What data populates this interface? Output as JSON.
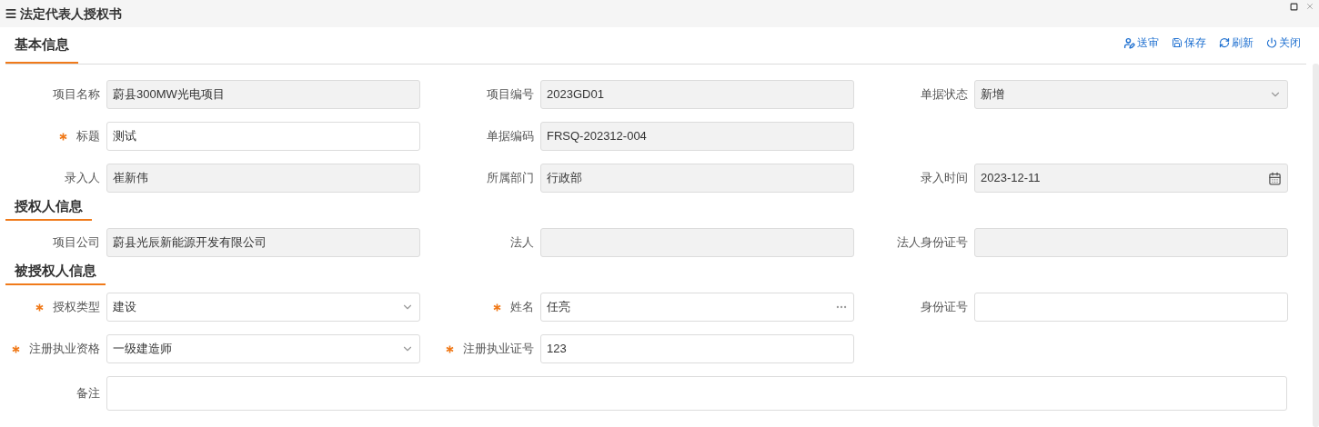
{
  "window": {
    "title": "法定代表人授权书"
  },
  "toolbar": [
    {
      "kind": "submit",
      "label": "送审"
    },
    {
      "kind": "save",
      "label": "保存"
    },
    {
      "kind": "refresh",
      "label": "刷新"
    },
    {
      "kind": "close",
      "label": "关闭"
    }
  ],
  "sections": [
    {
      "title": "基本信息",
      "rows": [
        [
          {
            "label": "项目名称",
            "value": "蔚县300MW光电项目",
            "kind": "text",
            "readonly": true,
            "required": false
          },
          {
            "label": "项目编号",
            "value": "2023GD01",
            "kind": "text",
            "readonly": true,
            "required": false
          },
          {
            "label": "单据状态",
            "value": "新增",
            "kind": "select",
            "readonly": true,
            "required": false
          }
        ],
        [
          {
            "label": "标题",
            "value": "测试",
            "kind": "text",
            "readonly": false,
            "required": true
          },
          {
            "label": "单据编码",
            "value": "FRSQ-202312-004",
            "kind": "text",
            "readonly": true,
            "required": false
          }
        ],
        [
          {
            "label": "录入人",
            "value": "崔新伟",
            "kind": "text",
            "readonly": true,
            "required": false
          },
          {
            "label": "所属部门",
            "value": "行政部",
            "kind": "text",
            "readonly": true,
            "required": false
          },
          {
            "label": "录入时间",
            "value": "2023-12-11",
            "kind": "date",
            "readonly": true,
            "required": false
          }
        ]
      ]
    },
    {
      "title": "授权人信息",
      "rows": [
        [
          {
            "label": "项目公司",
            "value": "蔚县光辰新能源开发有限公司",
            "kind": "text",
            "readonly": true,
            "required": false
          },
          {
            "label": "法人",
            "kind": "text",
            "readonly": true,
            "required": false
          },
          {
            "label": "法人身份证号",
            "kind": "text",
            "readonly": true,
            "required": false
          }
        ]
      ]
    },
    {
      "title": "被授权人信息",
      "rows": [
        [
          {
            "label": "授权类型",
            "value": "建设",
            "kind": "select",
            "readonly": false,
            "required": true
          },
          {
            "label": "姓名",
            "value": "任亮",
            "kind": "lookup",
            "readonly": false,
            "required": true
          },
          {
            "label": "身份证号",
            "kind": "text",
            "readonly": false,
            "required": false
          }
        ],
        [
          {
            "label": "注册执业资格",
            "value": "一级建造师",
            "kind": "select",
            "readonly": false,
            "required": true
          },
          {
            "label": "注册执业证号",
            "value": "123",
            "kind": "text",
            "readonly": false,
            "required": true
          }
        ],
        [
          {
            "label": "备注",
            "kind": "textarea",
            "readonly": false,
            "required": false
          }
        ]
      ]
    }
  ]
}
